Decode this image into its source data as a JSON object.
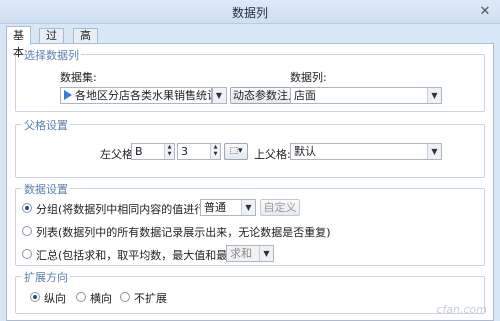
{
  "window": {
    "title": "数据列",
    "close_glyph": "✕"
  },
  "tabs": [
    {
      "label": "基本",
      "active": true
    },
    {
      "label": "过滤",
      "active": false
    },
    {
      "label": "高级",
      "active": false
    }
  ],
  "select_column": {
    "legend": "选择数据列",
    "dataset_label": "数据集:",
    "dataset_value": "各地区分店各类水果销售统计",
    "dynamic_param_button": "动态参数注入",
    "column_label": "数据列:",
    "column_value": "店面"
  },
  "parent_settings": {
    "legend": "父格设置",
    "left_parent_label": "左父格:",
    "left_col": "B",
    "left_row": "3",
    "upper_parent_label": "上父格:",
    "upper_value": "默认"
  },
  "data_settings": {
    "legend": "数据设置",
    "options": [
      {
        "label": "分组(将数据列中相同内容的值进行合并)",
        "selected": true
      },
      {
        "label": "列表(数据列中的所有数据记录展示出来，无论数据是否重复)",
        "selected": false
      },
      {
        "label": "汇总(包括求和，取平均数，最大值和最小值等)",
        "selected": false
      }
    ],
    "group_mode": "普通",
    "custom_button": "自定义",
    "aggregate_value": "求和"
  },
  "expand_direction": {
    "legend": "扩展方向",
    "options": [
      {
        "label": "纵向",
        "selected": true
      },
      {
        "label": "横向",
        "selected": false
      },
      {
        "label": "不扩展",
        "selected": false
      }
    ]
  },
  "watermark": "cfan.com"
}
